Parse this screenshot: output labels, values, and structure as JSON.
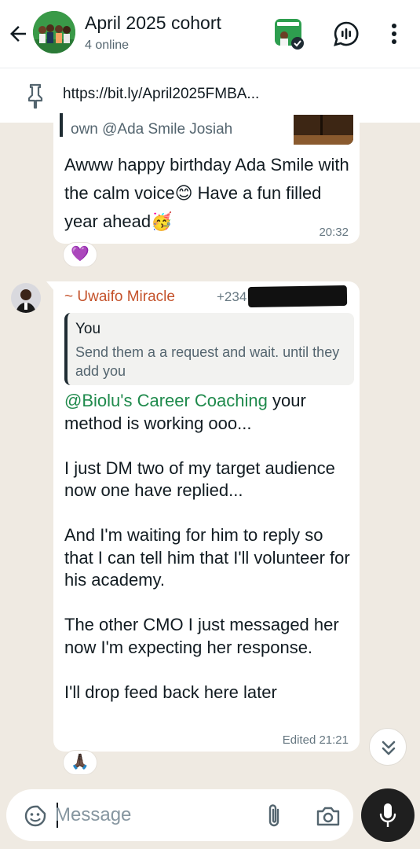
{
  "header": {
    "title": "April 2025 cohort",
    "subtitle": "4 online"
  },
  "pinned": {
    "text": "https://bit.ly/April2025FMBA..."
  },
  "messages": [
    {
      "quote_text": "own @Ada Smile Josiah",
      "text": "Awww happy birthday Ada Smile with the calm voice😊 Have a fun filled year ahead🥳",
      "time": "20:32",
      "reaction": "💜"
    },
    {
      "sender_name": "~ Uwaifo Miracle",
      "sender_phone": "+234",
      "reply_author": "You",
      "reply_text": "Send them a a request and wait. until they add you",
      "mention": "@Biolu's Career Coaching",
      "paragraph_1_rest": " your method is working ooo...",
      "paragraph_2": "I just DM two of my target audience now one have replied...",
      "paragraph_3": "And I'm waiting for him to reply so that I can tell him that I'll volunteer for his academy.",
      "paragraph_4": "The other CMO I just messaged her now I'm expecting her response.",
      "paragraph_5": "I'll drop feed back here later",
      "time": "Edited 21:21",
      "reaction": "🙏🏿"
    }
  ],
  "composer": {
    "placeholder": "Message"
  },
  "colors": {
    "chat_background": "#efeae2",
    "sender_name": "#c4522b",
    "mention": "#1f8a4c",
    "mic_button": "#1f1f1f"
  },
  "icons": [
    "back-arrow-icon",
    "voice-chat-icon",
    "more-vert-icon",
    "pin-icon",
    "chevrons-down-icon",
    "sticker-icon",
    "paperclip-icon",
    "camera-icon",
    "mic-icon"
  ]
}
